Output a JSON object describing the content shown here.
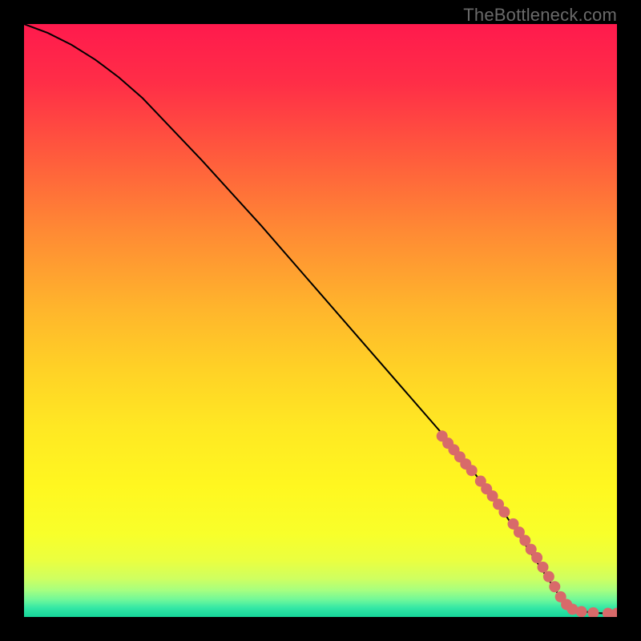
{
  "watermark": "TheBottleneck.com",
  "chart_data": {
    "type": "line",
    "title": "",
    "xlabel": "",
    "ylabel": "",
    "xlim": [
      0,
      100
    ],
    "ylim": [
      0,
      100
    ],
    "grid": false,
    "series": [
      {
        "name": "curve",
        "x": [
          0,
          4,
          8,
          12,
          16,
          20,
          30,
          40,
          50,
          60,
          70,
          75,
          80,
          82,
          84,
          86,
          88,
          90,
          92,
          94,
          96,
          98,
          100
        ],
        "y": [
          100,
          98.5,
          96.5,
          94,
          91,
          87.5,
          77,
          66,
          54.5,
          43,
          31.5,
          25.5,
          19,
          16,
          13,
          10,
          7,
          4,
          2,
          1,
          0.7,
          0.6,
          0.6
        ]
      }
    ],
    "points": {
      "name": "markers",
      "x": [
        70.5,
        71.5,
        72.5,
        73.5,
        74.5,
        75.5,
        77.0,
        78.0,
        79.0,
        80.0,
        81.0,
        82.5,
        83.5,
        84.5,
        85.5,
        86.5,
        87.5,
        88.5,
        89.5,
        90.5,
        91.5,
        92.5,
        94.0,
        96.0,
        98.5,
        100.0
      ],
      "y": [
        30.5,
        29.3,
        28.2,
        27.0,
        25.8,
        24.7,
        22.9,
        21.6,
        20.4,
        19.0,
        17.7,
        15.7,
        14.3,
        12.9,
        11.4,
        10.0,
        8.4,
        6.8,
        5.1,
        3.4,
        2.1,
        1.3,
        0.9,
        0.7,
        0.6,
        0.6
      ]
    },
    "gradient_stops": [
      {
        "pos": 0.0,
        "color": "#ff1a4d"
      },
      {
        "pos": 0.1,
        "color": "#ff2e47"
      },
      {
        "pos": 0.22,
        "color": "#ff5a3d"
      },
      {
        "pos": 0.35,
        "color": "#ff8a34"
      },
      {
        "pos": 0.48,
        "color": "#ffb52c"
      },
      {
        "pos": 0.58,
        "color": "#ffd126"
      },
      {
        "pos": 0.68,
        "color": "#ffe823"
      },
      {
        "pos": 0.78,
        "color": "#fff720"
      },
      {
        "pos": 0.86,
        "color": "#f8ff2a"
      },
      {
        "pos": 0.905,
        "color": "#eaff40"
      },
      {
        "pos": 0.935,
        "color": "#cfff60"
      },
      {
        "pos": 0.955,
        "color": "#a6ff80"
      },
      {
        "pos": 0.972,
        "color": "#6cf79b"
      },
      {
        "pos": 0.985,
        "color": "#33e7a5"
      },
      {
        "pos": 1.0,
        "color": "#16d59a"
      }
    ],
    "marker_color": "#d86a6a",
    "line_color": "#000000"
  }
}
